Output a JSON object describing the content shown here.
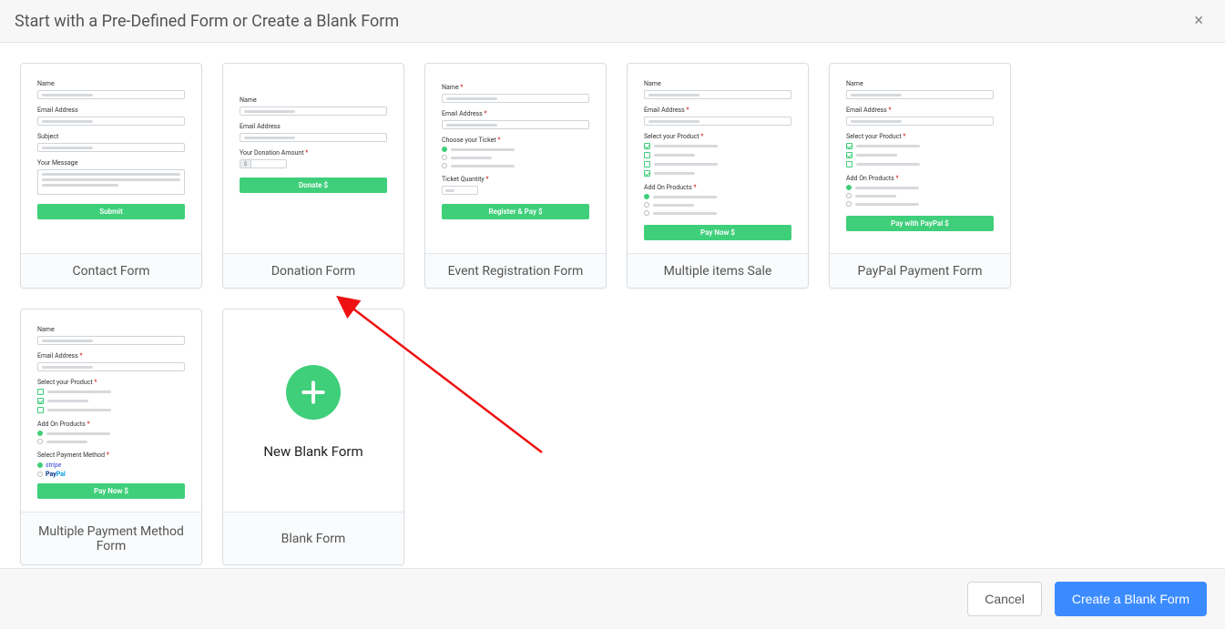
{
  "header": {
    "title": "Start with a Pre-Defined Form or Create a Blank Form"
  },
  "cards": [
    {
      "label": "Contact Form",
      "preview": {
        "name": "Name",
        "email": "Email Address",
        "subject": "Subject",
        "message": "Your Message",
        "button": "Submit"
      }
    },
    {
      "label": "Donation Form",
      "preview": {
        "name": "Name",
        "email": "Email Address",
        "amount": "Your Donation Amount",
        "currency": "$",
        "button": "Donate $"
      }
    },
    {
      "label": "Event Registration Form",
      "preview": {
        "name": "Name",
        "email": "Email Address",
        "ticket": "Choose your Ticket",
        "qty": "Ticket Quantity",
        "button": "Register & Pay $"
      }
    },
    {
      "label": "Multiple items Sale",
      "preview": {
        "name": "Name",
        "email": "Email Address",
        "product": "Select your Product",
        "addon": "Add On Products",
        "button": "Pay Now $"
      }
    },
    {
      "label": "PayPal Payment Form",
      "preview": {
        "name": "Name",
        "email": "Email Address",
        "product": "Select your Product",
        "addon": "Add On Products",
        "button": "Pay with PayPal $"
      }
    },
    {
      "label": "Multiple Payment Method Form",
      "preview": {
        "name": "Name",
        "email": "Email Address",
        "product": "Select your Product",
        "addon": "Add On Products",
        "paymethod": "Select Payment Method",
        "stripe": "stripe",
        "paypal_a": "Pay",
        "paypal_b": "Pal",
        "button": "Pay Now $"
      }
    },
    {
      "label": "Blank Form",
      "preview": {
        "blank_text": "New Blank Form"
      }
    }
  ],
  "footer": {
    "cancel": "Cancel",
    "primary": "Create a Blank Form"
  }
}
